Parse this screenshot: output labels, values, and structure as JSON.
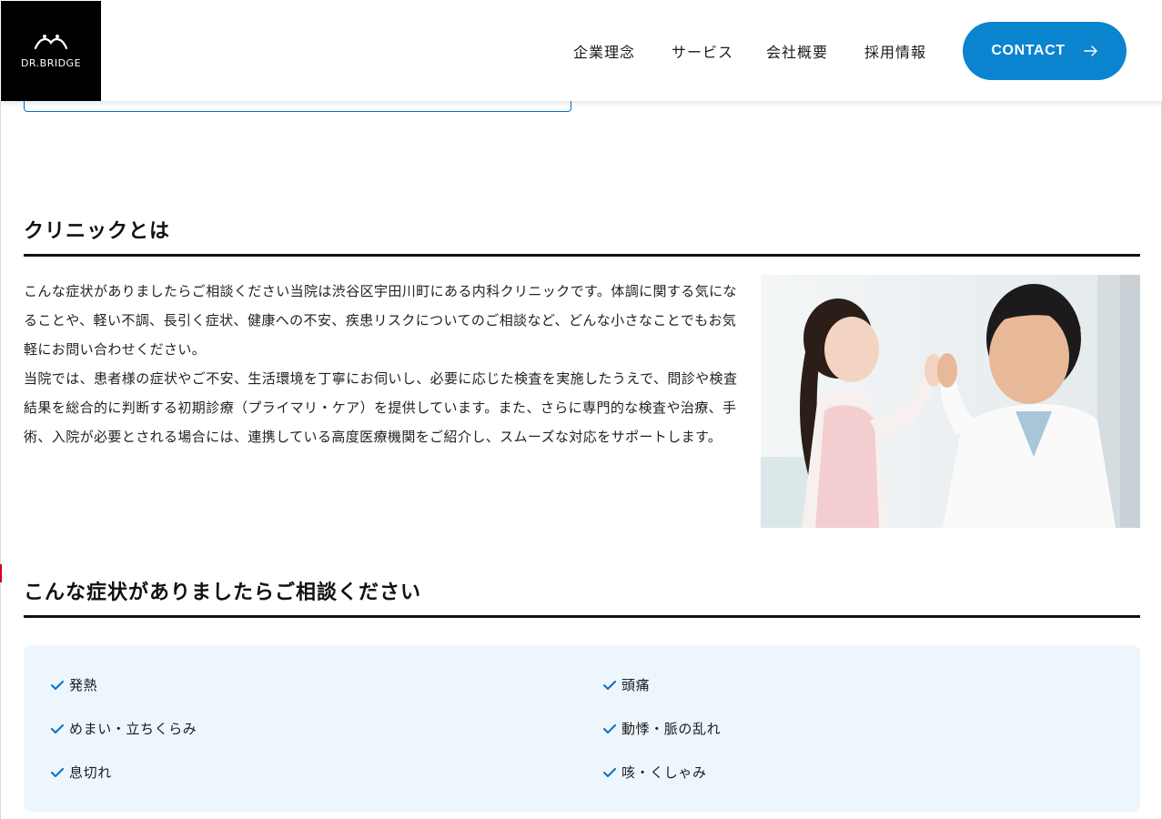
{
  "header": {
    "logo_text": "DR.BRIDGE",
    "nav": [
      "企業理念",
      "サービス",
      "会社概要",
      "採用情報"
    ],
    "contact_label": "CONTACT"
  },
  "clinic": {
    "title": "クリニックとは",
    "paragraph_1": "こんな症状がありましたらご相談ください当院は渋谷区宇田川町にある内科クリニックです。体調に関する気になることや、軽い不調、長引く症状、健康への不安、疾患リスクについてのご相談など、どんな小さなことでもお気軽にお問い合わせください。",
    "paragraph_2": "当院では、患者様の症状やご不安、生活環境を丁寧にお伺いし、必要に応じた検査を実施したうえで、問診や検査結果を総合的に判断する初期診療（プライマリ・ケア）を提供しています。また、さらに専門的な検査や治療、手術、入院が必要とされる場合には、連携している高度医療機関をご紹介し、スムーズな対応をサポートします。"
  },
  "symptoms": {
    "title": "こんな症状がありましたらご相談ください",
    "items": [
      "発熱",
      "頭痛",
      "めまい・立ちくらみ",
      "動悸・脈の乱れ",
      "息切れ",
      "咳・くしゃみ"
    ]
  },
  "colors": {
    "accent": "#0a84cf",
    "symptom_bg": "#eef6fd",
    "check": "#0a6fc2"
  }
}
